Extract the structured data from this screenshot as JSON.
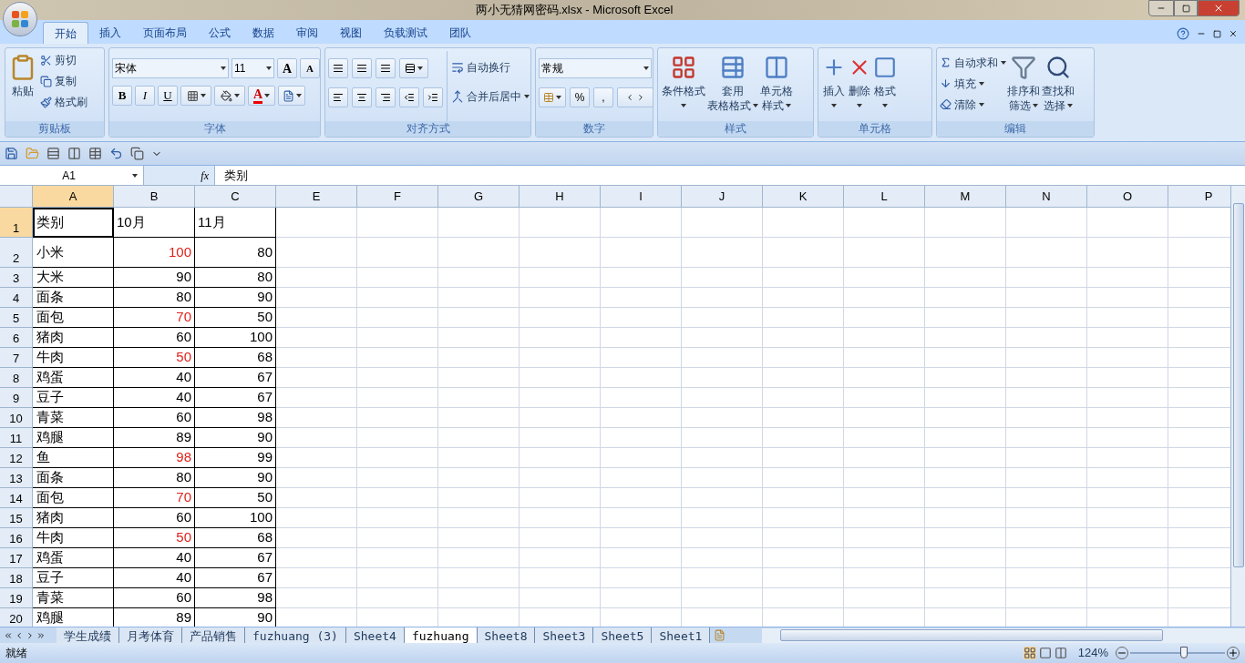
{
  "window": {
    "title": "两小无猜网密码.xlsx - Microsoft Excel"
  },
  "tabs": [
    {
      "label": "开始",
      "selected": true
    },
    {
      "label": "插入",
      "selected": false
    },
    {
      "label": "页面布局",
      "selected": false
    },
    {
      "label": "公式",
      "selected": false
    },
    {
      "label": "数据",
      "selected": false
    },
    {
      "label": "审阅",
      "selected": false
    },
    {
      "label": "视图",
      "selected": false
    },
    {
      "label": "负载测试",
      "selected": false
    },
    {
      "label": "团队",
      "selected": false
    }
  ],
  "clipboard": {
    "title": "剪贴板",
    "paste": "粘贴",
    "items": [
      "剪切",
      "复制",
      "格式刷"
    ]
  },
  "font": {
    "title": "字体",
    "name": "宋体",
    "size": "11",
    "grow_labels": [
      "A",
      "A"
    ],
    "style_buttons": [
      "B",
      "I",
      "U"
    ],
    "color_label": "A"
  },
  "alignment": {
    "title": "对齐方式",
    "wrap": "自动换行",
    "merge": "合并后居中"
  },
  "number": {
    "title": "数字",
    "format": "常规",
    "symbols": [
      "%",
      ","
    ]
  },
  "styles": {
    "title": "样式",
    "items": [
      {
        "lines": [
          "条件格式"
        ]
      },
      {
        "lines": [
          "套用",
          "表格格式"
        ]
      },
      {
        "lines": [
          "单元格",
          "样式"
        ]
      }
    ]
  },
  "cells": {
    "title": "单元格",
    "items": [
      "插入",
      "删除",
      "格式"
    ]
  },
  "editing": {
    "title": "编辑",
    "small": [
      "自动求和",
      "填充",
      "清除"
    ],
    "big": [
      {
        "lines": [
          "排序和",
          "筛选"
        ]
      },
      {
        "lines": [
          "查找和",
          "选择"
        ]
      }
    ]
  },
  "name_box": "A1",
  "function_label": "fx",
  "formula": "类别",
  "columns": [
    {
      "label": "A",
      "selected": true
    },
    {
      "label": "B",
      "selected": false
    },
    {
      "label": "C",
      "selected": false
    },
    {
      "label": "E",
      "selected": false
    },
    {
      "label": "F",
      "selected": false
    },
    {
      "label": "G",
      "selected": false
    },
    {
      "label": "H",
      "selected": false
    },
    {
      "label": "I",
      "selected": false
    },
    {
      "label": "J",
      "selected": false
    },
    {
      "label": "K",
      "selected": false
    },
    {
      "label": "L",
      "selected": false
    },
    {
      "label": "M",
      "selected": false
    },
    {
      "label": "N",
      "selected": false
    },
    {
      "label": "O",
      "selected": false
    },
    {
      "label": "P",
      "selected": false
    }
  ],
  "rows": [
    {
      "number": "1",
      "selected": true,
      "category": "类别",
      "oct": "10月",
      "nov": "11月",
      "flagged": false
    },
    {
      "number": "2",
      "selected": false,
      "category": "小米",
      "oct": "100",
      "nov": "80",
      "flagged": true
    },
    {
      "number": "3",
      "selected": false,
      "category": "大米",
      "oct": "90",
      "nov": "80",
      "flagged": false
    },
    {
      "number": "4",
      "selected": false,
      "category": "面条",
      "oct": "80",
      "nov": "90",
      "flagged": false
    },
    {
      "number": "5",
      "selected": false,
      "category": "面包",
      "oct": "70",
      "nov": "50",
      "flagged": true
    },
    {
      "number": "6",
      "selected": false,
      "category": "猪肉",
      "oct": "60",
      "nov": "100",
      "flagged": false
    },
    {
      "number": "7",
      "selected": false,
      "category": "牛肉",
      "oct": "50",
      "nov": "68",
      "flagged": true
    },
    {
      "number": "8",
      "selected": false,
      "category": "鸡蛋",
      "oct": "40",
      "nov": "67",
      "flagged": false
    },
    {
      "number": "9",
      "selected": false,
      "category": "豆子",
      "oct": "40",
      "nov": "67",
      "flagged": false
    },
    {
      "number": "10",
      "selected": false,
      "category": "青菜",
      "oct": "60",
      "nov": "98",
      "flagged": false
    },
    {
      "number": "11",
      "selected": false,
      "category": "鸡腿",
      "oct": "89",
      "nov": "90",
      "flagged": false
    },
    {
      "number": "12",
      "selected": false,
      "category": "鱼",
      "oct": "98",
      "nov": "99",
      "flagged": true
    },
    {
      "number": "13",
      "selected": false,
      "category": "面条",
      "oct": "80",
      "nov": "90",
      "flagged": false
    },
    {
      "number": "14",
      "selected": false,
      "category": "面包",
      "oct": "70",
      "nov": "50",
      "flagged": true
    },
    {
      "number": "15",
      "selected": false,
      "category": "猪肉",
      "oct": "60",
      "nov": "100",
      "flagged": false
    },
    {
      "number": "16",
      "selected": false,
      "category": "牛肉",
      "oct": "50",
      "nov": "68",
      "flagged": true
    },
    {
      "number": "17",
      "selected": false,
      "category": "鸡蛋",
      "oct": "40",
      "nov": "67",
      "flagged": false
    },
    {
      "number": "18",
      "selected": false,
      "category": "豆子",
      "oct": "40",
      "nov": "67",
      "flagged": false
    },
    {
      "number": "19",
      "selected": false,
      "category": "青菜",
      "oct": "60",
      "nov": "98",
      "flagged": false
    },
    {
      "number": "20",
      "selected": false,
      "category": "鸡腿",
      "oct": "89",
      "nov": "90",
      "flagged": false
    }
  ],
  "sheets": [
    {
      "label": "学生成绩",
      "selected": false
    },
    {
      "label": "月考体育",
      "selected": false
    },
    {
      "label": "产品销售",
      "selected": false
    },
    {
      "label": "fuzhuang (3)",
      "selected": false
    },
    {
      "label": "Sheet4",
      "selected": false
    },
    {
      "label": "fuzhuang",
      "selected": true
    },
    {
      "label": "Sheet8",
      "selected": false
    },
    {
      "label": "Sheet3",
      "selected": false
    },
    {
      "label": "Sheet5",
      "selected": false
    },
    {
      "label": "Sheet1",
      "selected": false
    }
  ],
  "status": "就绪",
  "zoom": {
    "reading": "124%",
    "level": 0.57
  }
}
